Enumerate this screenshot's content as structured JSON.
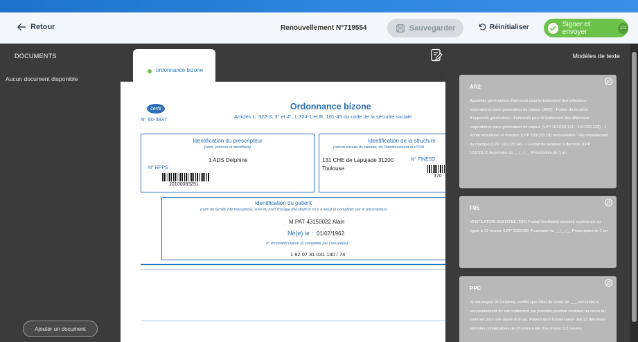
{
  "header": {
    "back_label": "Retour",
    "title": "Renouvellement N°719554",
    "save_label": "Sauvegarder",
    "reset_label": "Réinitialiser",
    "sign_label": "Signer et envoyer",
    "sign_count": "1/1"
  },
  "colors": {
    "top_strip": "#2f86e0",
    "accent_green": "#6cc24a",
    "form_blue": "#2c6fb0",
    "panel_dark": "#3b3b3b",
    "card_grey": "#b8b8b8"
  },
  "icons": {
    "back": "arrow-left-icon",
    "save": "floppy-disk-icon",
    "reset": "rotate-left-icon",
    "sign": "check-icon",
    "documents": "document-list-icon",
    "templates": "document-edit-icon",
    "card_edit": "pencil-icon"
  },
  "left_panel": {
    "title": "DOCUMENTS",
    "empty_text": "Aucun document disponible",
    "add_button": "Ajouter un document"
  },
  "tab": {
    "label": "ordonnance bizone"
  },
  "form": {
    "cerfa_logo": "cerfa",
    "cerfa_number": "N° 60-3937",
    "title": "Ordonnance bizone",
    "subtitle": "Articles L. 322-3, 3° et 4°, L 324-1 et R. 161-45 du code de la sécurité sociale",
    "prescriber": {
      "title": "Identification du prescripteur",
      "hint": "(nom, prénom et identifiant)",
      "name": "1 ADS Delphine",
      "rpps_label": "N° RPPS",
      "rpps_value": "10100083251"
    },
    "structure": {
      "title": "Identification de la structure",
      "hint": "(raison sociale du cabinet, de l'établissement et n°FIN",
      "address_line1": "131 CHE de Lapujade 31200",
      "address_line2": "Toulouse",
      "finess_label": "N° FINESS",
      "finess_value": "370"
    },
    "patient": {
      "title": "Identification du patient",
      "hint": "(nom de famille (de naissance), suivi du nom d'usage (facultatif et s'il y a lieu)) (à compléter par le prescripteur)",
      "name": "M PAT 43150022 Alain",
      "birth_label": "Né(e) le :",
      "birth_value": "01/07/1962",
      "immat_hint": "n° d'immatriculation (à compléter par l'assuré(e))",
      "immat_value": "1 62 07 31 031 130 / 74"
    }
  },
  "right_panel": {
    "title": "Modèles de texte",
    "cards": [
      {
        "code": "AR2",
        "text": "Appareils générateurs d'aérosols pour le traitement des affections respiratoires sans générateur de vapeur (AR2) - Forfait de location d'appareils générateurs d'aérosols pour le traitement des affections respiratoires sans générateur de vapeur (LPP 101C03.121 - 101C03.122) - 1 Achat nébuliseur et masque (LPP 101C03.13) renouvelable - Renouvellement du masque (LPP 101C03.14) - 1 Forfait de livraison à domicile (LPP 101C01.2) A compter du __/__/__ Prescription de 1 an"
      },
      {
        "code": "F05",
        "text": "VENTILATION ASSISTEE (F05) Forfait Ventilation assistée supérieure ou égale à 12 heures (LPP 1182030) A compter du __/__/__ Prescription de 1 an"
      },
      {
        "code": "PPC",
        "text": "Je soussigné Dr Delphine, certifie que l'état de santé de ___ nécessite le renouvellement de son traitement par pression positive continue au cours du sommeil pour une durée d'un an. Patient dont l'observance des 12 dernières périodes consécutives de 28 jours a été d'au moins 112 heures"
      }
    ]
  }
}
